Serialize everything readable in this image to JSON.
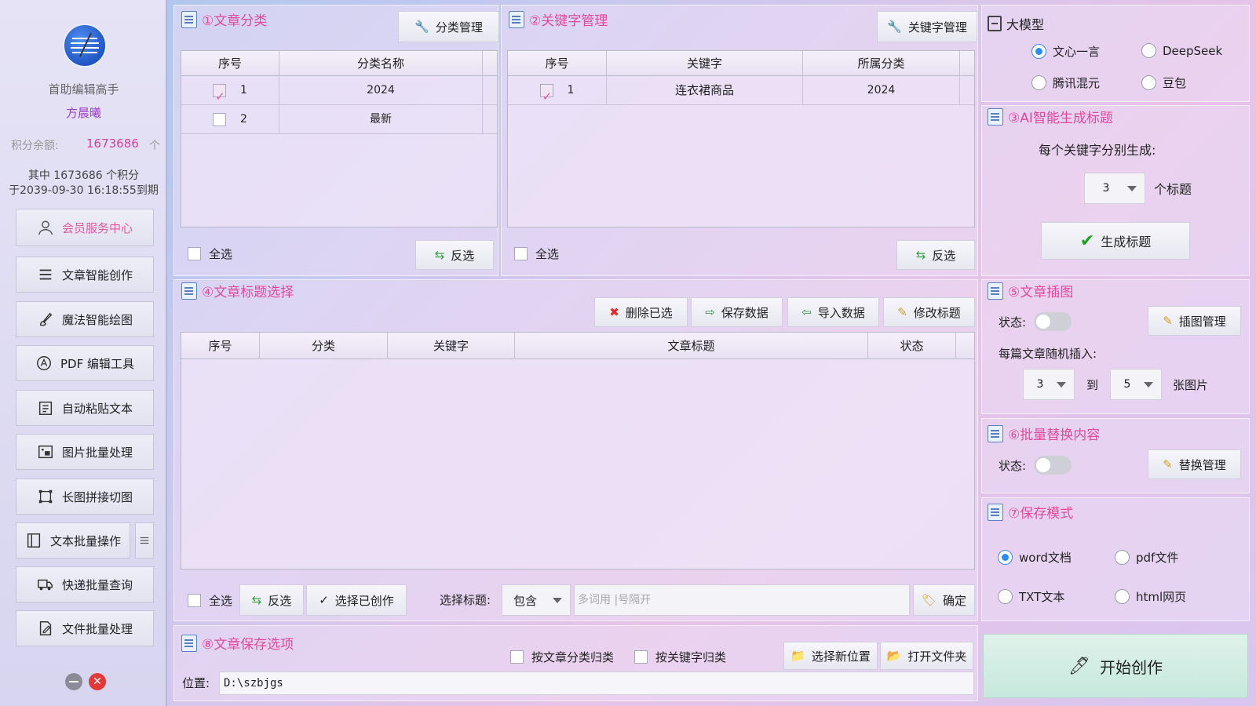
{
  "sidebar": {
    "app_name": "首助编辑高手",
    "user": "方晨曦",
    "points_label": "积分余额:",
    "points_value": "1673686",
    "points_unit": "个",
    "points_detail_line1": "其中 1673686 个积分",
    "points_detail_line2": "于2039-09-30 16:18:55到期",
    "member_center": "会员服务中心",
    "items": [
      {
        "label": "文章智能创作",
        "icon": "list-icon"
      },
      {
        "label": "魔法智能绘图",
        "icon": "brush-icon"
      },
      {
        "label": "PDF 编辑工具",
        "icon": "pdf-icon"
      },
      {
        "label": "自动粘贴文本",
        "icon": "paste-icon"
      },
      {
        "label": "图片批量处理",
        "icon": "image-icon"
      },
      {
        "label": "长图拼接切图",
        "icon": "crop-icon"
      },
      {
        "label": "文本批量操作",
        "icon": "text-icon"
      },
      {
        "label": "快递批量查询",
        "icon": "truck-icon"
      },
      {
        "label": "文件批量处理",
        "icon": "file-icon"
      }
    ]
  },
  "category": {
    "title": "①文章分类",
    "manage_btn": "分类管理",
    "headers": [
      "序号",
      "分类名称"
    ],
    "rows": [
      {
        "no": "1",
        "name": "2024",
        "checked": true
      },
      {
        "no": "2",
        "name": "最新",
        "checked": false
      }
    ],
    "select_all": "全选",
    "invert": "反选"
  },
  "keyword": {
    "title": "②关键字管理",
    "manage_btn": "关键字管理",
    "headers": [
      "序号",
      "关键字",
      "所属分类"
    ],
    "rows": [
      {
        "no": "1",
        "keyword": "连衣裙商品",
        "category": "2024",
        "checked": true
      }
    ],
    "select_all": "全选",
    "invert": "反选"
  },
  "model": {
    "title": "大模型",
    "options": [
      {
        "label": "文心一言",
        "selected": true
      },
      {
        "label": "DeepSeek",
        "selected": false
      },
      {
        "label": "腾讯混元",
        "selected": false
      },
      {
        "label": "豆包",
        "selected": false
      }
    ]
  },
  "ai_title": {
    "title": "③AI智能生成标题",
    "desc": "每个关键字分别生成:",
    "count": "3",
    "unit": "个标题",
    "generate_btn": "生成标题"
  },
  "titles": {
    "title": "④文章标题选择",
    "delete_btn": "删除已选",
    "save_btn": "保存数据",
    "import_btn": "导入数据",
    "edit_btn": "修改标题",
    "headers": [
      "序号",
      "分类",
      "关键字",
      "文章标题",
      "状态"
    ],
    "select_all": "全选",
    "invert": "反选",
    "select_created": "选择已创作",
    "filter_label": "选择标题:",
    "filter_mode": "包含",
    "filter_placeholder": "多词用 |号隔开",
    "confirm": "确定"
  },
  "insert": {
    "title": "⑤文章插图",
    "status_label": "状态:",
    "manage_btn": "插图管理",
    "desc": "每篇文章随机插入:",
    "from": "3",
    "to_label": "到",
    "to": "5",
    "unit": "张图片"
  },
  "replace": {
    "title": "⑥批量替换内容",
    "status_label": "状态:",
    "manage_btn": "替换管理"
  },
  "save_mode": {
    "title": "⑦保存模式",
    "options": [
      {
        "label": "word文档",
        "selected": true
      },
      {
        "label": "pdf文件",
        "selected": false
      },
      {
        "label": "TXT文本",
        "selected": false
      },
      {
        "label": "html网页",
        "selected": false
      }
    ]
  },
  "save_opts": {
    "title": "⑧文章保存选项",
    "by_category": "按文章分类归类",
    "by_keyword": "按关键字归类",
    "choose_btn": "选择新位置",
    "open_btn": "打开文件夹",
    "path_label": "位置:",
    "path": "D:\\szbjgs"
  },
  "start_btn": "开始创作"
}
